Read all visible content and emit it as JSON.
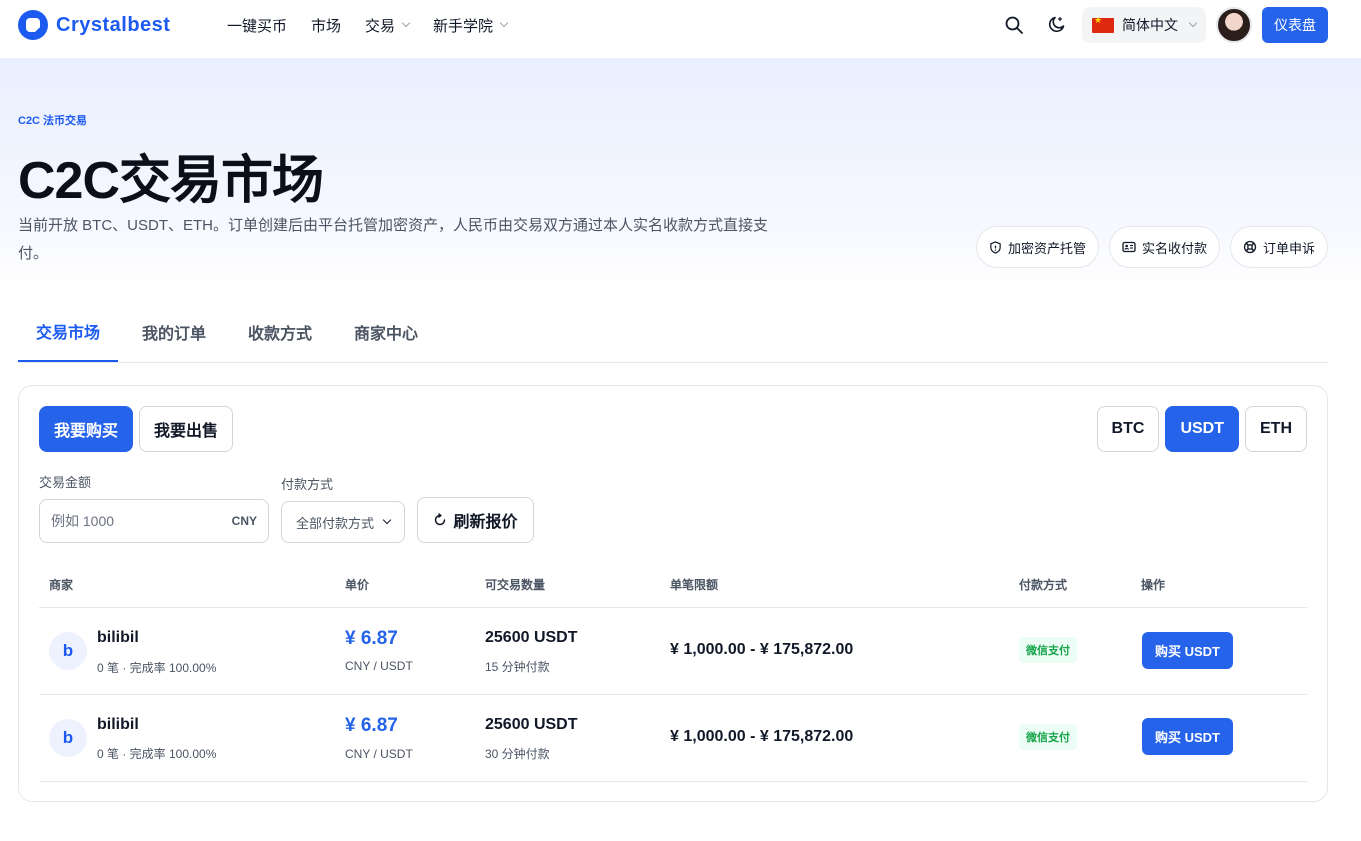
{
  "brand": {
    "name": "Crystalbest",
    "color": "#1d5bf0"
  },
  "nav": {
    "items": [
      {
        "label": "一键买币",
        "dropdown": false
      },
      {
        "label": "市场",
        "dropdown": false
      },
      {
        "label": "交易",
        "dropdown": true
      },
      {
        "label": "新手学院",
        "dropdown": true
      }
    ],
    "language": "简体中文",
    "dashboard_label": "仪表盘"
  },
  "hero": {
    "eyebrow": "C2C 法币交易",
    "title": "C2C交易市场",
    "description": "当前开放 BTC、USDT、ETH。订单创建后由平台托管加密资产，人民币由交易双方通过本人实名收款方式直接支付。",
    "chips": [
      {
        "icon": "shield-icon",
        "label": "加密资产托管"
      },
      {
        "icon": "id-card-icon",
        "label": "实名收付款"
      },
      {
        "icon": "lifebuoy-icon",
        "label": "订单申诉"
      }
    ]
  },
  "tabs": [
    "交易市场",
    "我的订单",
    "收款方式",
    "商家中心"
  ],
  "active_tab": 0,
  "trade": {
    "buy_label": "我要购买",
    "sell_label": "我要出售",
    "coins": [
      "BTC",
      "USDT",
      "ETH"
    ],
    "active_coin": "USDT",
    "amount_label": "交易金额",
    "amount_placeholder": "例如 1000",
    "amount_unit": "CNY",
    "pay_label": "付款方式",
    "pay_selected": "全部付款方式",
    "refresh_label": "刷新报价"
  },
  "table": {
    "headers": [
      "商家",
      "单价",
      "可交易数量",
      "单笔限额",
      "付款方式",
      "操作"
    ],
    "rows": [
      {
        "initial": "b",
        "merchant": "bilibil",
        "stats": "0 笔 · 完成率 100.00%",
        "price": "¥ 6.87",
        "price_unit": "CNY / USDT",
        "quantity": "25600 USDT",
        "pay_time": "15 分钟付款",
        "limit": "¥ 1,000.00 - ¥ 175,872.00",
        "payment": "微信支付",
        "action": "购买 USDT"
      },
      {
        "initial": "b",
        "merchant": "bilibil",
        "stats": "0 笔 · 完成率 100.00%",
        "price": "¥ 6.87",
        "price_unit": "CNY / USDT",
        "quantity": "25600 USDT",
        "pay_time": "30 分钟付款",
        "limit": "¥ 1,000.00 - ¥ 175,872.00",
        "payment": "微信支付",
        "action": "购买 USDT"
      }
    ]
  }
}
